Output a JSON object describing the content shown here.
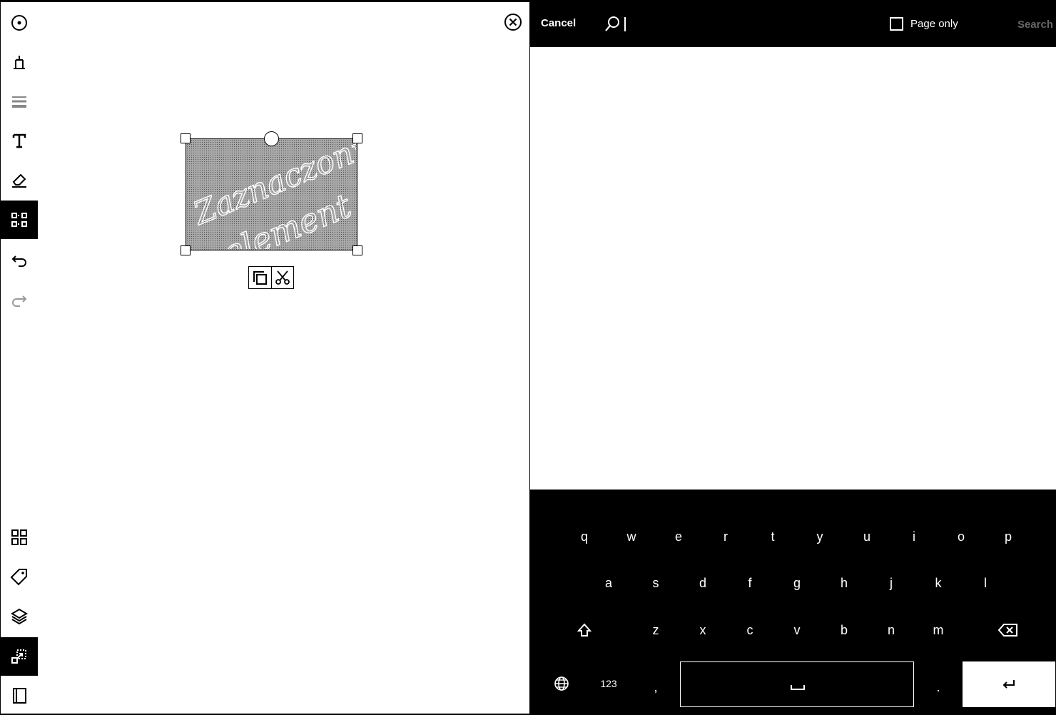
{
  "toolbar": {
    "tools": [
      {
        "name": "pen-tool",
        "active": false
      },
      {
        "name": "marker-tool",
        "active": false
      },
      {
        "name": "stroke-width-tool",
        "active": false
      },
      {
        "name": "text-tool",
        "active": false
      },
      {
        "name": "eraser-tool",
        "active": false
      },
      {
        "name": "selection-tool",
        "active": true
      },
      {
        "name": "undo-button",
        "active": false
      },
      {
        "name": "redo-button",
        "active": false
      }
    ],
    "bottom_tools": [
      {
        "name": "page-overview-button",
        "active": false
      },
      {
        "name": "tags-button",
        "active": false
      },
      {
        "name": "layers-button",
        "active": false
      },
      {
        "name": "zoom-fit-button",
        "active": true
      },
      {
        "name": "notebook-button",
        "active": false
      }
    ]
  },
  "canvas": {
    "handwriting_lines": [
      "Zaznaczony",
      "element"
    ]
  },
  "selection_menu": {
    "actions": [
      "copy",
      "cut"
    ]
  },
  "search": {
    "cancel_label": "Cancel",
    "query": "",
    "page_only_label": "Page only",
    "page_only_checked": false,
    "search_label": "Search"
  },
  "keyboard": {
    "row1": [
      "q",
      "w",
      "e",
      "r",
      "t",
      "y",
      "u",
      "i",
      "o",
      "p"
    ],
    "row2": [
      "a",
      "s",
      "d",
      "f",
      "g",
      "h",
      "j",
      "k",
      "l"
    ],
    "row3": [
      "z",
      "x",
      "c",
      "v",
      "b",
      "n",
      "m"
    ],
    "numbers_label": "123",
    "comma": ",",
    "period": "."
  }
}
